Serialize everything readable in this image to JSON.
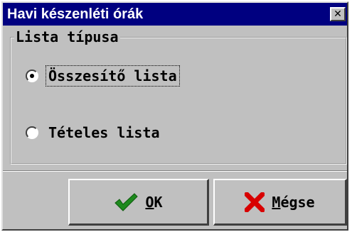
{
  "window": {
    "title": "Havi készenléti órák",
    "close_glyph": "✕"
  },
  "group": {
    "legend": "Lista típusa",
    "options": [
      {
        "label": "Összesítő lista",
        "selected": true,
        "focused": true
      },
      {
        "label": "Tételes lista",
        "selected": false,
        "focused": false
      }
    ]
  },
  "buttons": {
    "ok": {
      "mnemonic": "O",
      "rest": "K",
      "icon": "checkmark-icon",
      "icon_color": "#1e8a1e"
    },
    "cancel": {
      "mnemonic": "M",
      "rest": "égse",
      "icon": "x-icon",
      "icon_color": "#d80000"
    }
  },
  "colors": {
    "title_bar": "#000080",
    "face": "#c0c0c0"
  }
}
